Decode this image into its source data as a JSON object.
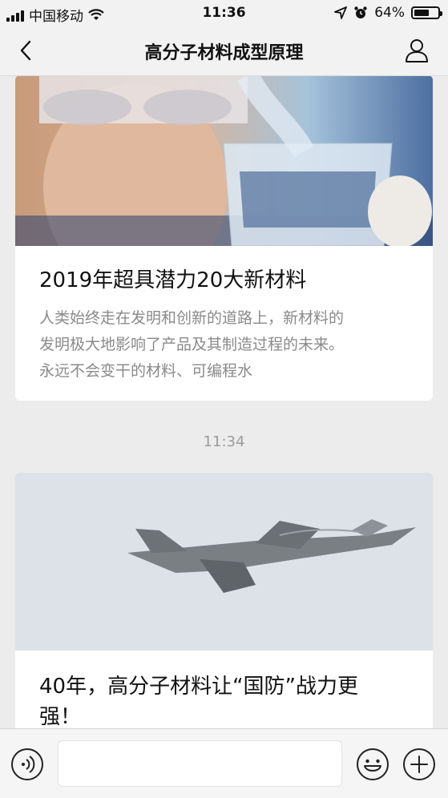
{
  "status_bar": {
    "carrier": "中国移动",
    "time": "11:36",
    "battery_percent": "64%",
    "battery_level": 0.64,
    "icons": [
      "signal-icon",
      "wifi-icon",
      "location-icon",
      "alarm-icon",
      "battery-icon"
    ]
  },
  "nav": {
    "title": "高分子材料成型原理",
    "icons": [
      "back-chevron-icon",
      "profile-icon"
    ]
  },
  "messages": [
    {
      "headline": "2019年超具潜力20大新材料",
      "summary_lines": [
        "人类始终走在发明和创新的道路上，新材料的",
        "发明极大地影响了产品及其制造过程的未来。",
        "永远不会变干的材料、可编程水"
      ],
      "image": "lab-beaker-photo"
    },
    {
      "timestamp": "11:34",
      "headline_lines": [
        "40年，高分子材料让“国防”战力更",
        "强！"
      ],
      "image": "stealth-jet-photo"
    }
  ],
  "input_bar": {
    "icons": [
      "voice-icon",
      "emoji-icon",
      "plus-icon"
    ]
  }
}
